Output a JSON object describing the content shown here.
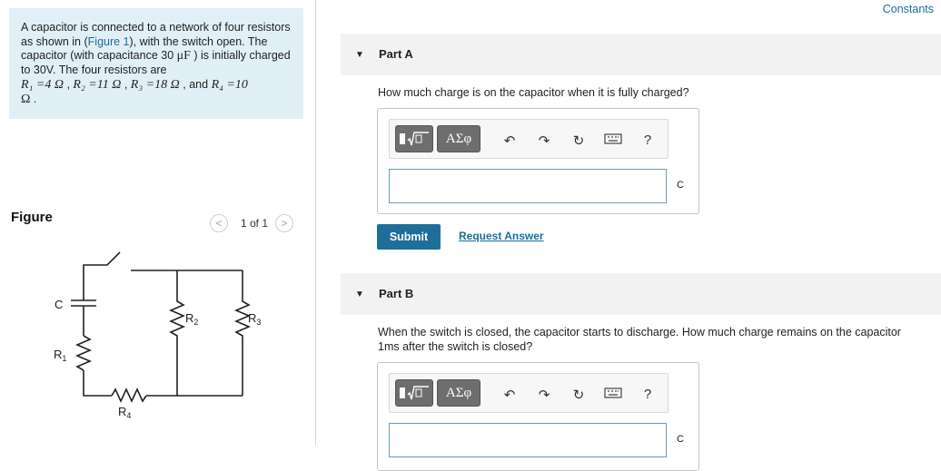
{
  "problem": {
    "text_1": "A capacitor is connected to a network of four resistors as shown in (",
    "figure_link": "Figure 1",
    "text_2": "), with the switch open. The capacitor (with capacitance 30 ",
    "capacitance_unit": "μF",
    "text_3": " ) is initially charged to 30V. The four resistors are",
    "r1": "R₁ =4 Ω",
    "r2": "R₂ =11 Ω",
    "r3": "R₃ =18 Ω",
    "and": "and",
    "r4": "R₄ =10",
    "omega": "Ω"
  },
  "figure": {
    "label": "Figure",
    "pager": "1 of 1",
    "prev_icon": "chevron-left-icon",
    "next_icon": "chevron-right-icon",
    "circuit_labels": {
      "c": "C",
      "r1": "R",
      "r1_sub": "1",
      "r2": "R",
      "r2_sub": "2",
      "r3": "R",
      "r3_sub": "3",
      "r4": "R",
      "r4_sub": "4"
    }
  },
  "header": {
    "constants": "Constants"
  },
  "part_a": {
    "title": "Part A",
    "question": "How much charge is on the capacitor when it is fully charged?",
    "unit": "C",
    "submit": "Submit",
    "request_answer": "Request Answer"
  },
  "part_b": {
    "title": "Part B",
    "question_line1": "When the switch is closed, the capacitor starts to discharge. How much charge remains on the capacitor",
    "question_line2": "1ms after the switch is closed?",
    "unit": "C"
  },
  "toolbar": {
    "greek": "ΑΣφ",
    "help": "?",
    "icons": [
      "templates-icon",
      "greek-symbols-icon",
      "undo-icon",
      "redo-icon",
      "reset-icon",
      "keyboard-icon",
      "help-icon"
    ]
  },
  "colors": {
    "accent": "#1d6f99",
    "link": "#1b6d9e",
    "problem_bg": "#e1f0f6",
    "band_bg": "#f2f2f2"
  }
}
